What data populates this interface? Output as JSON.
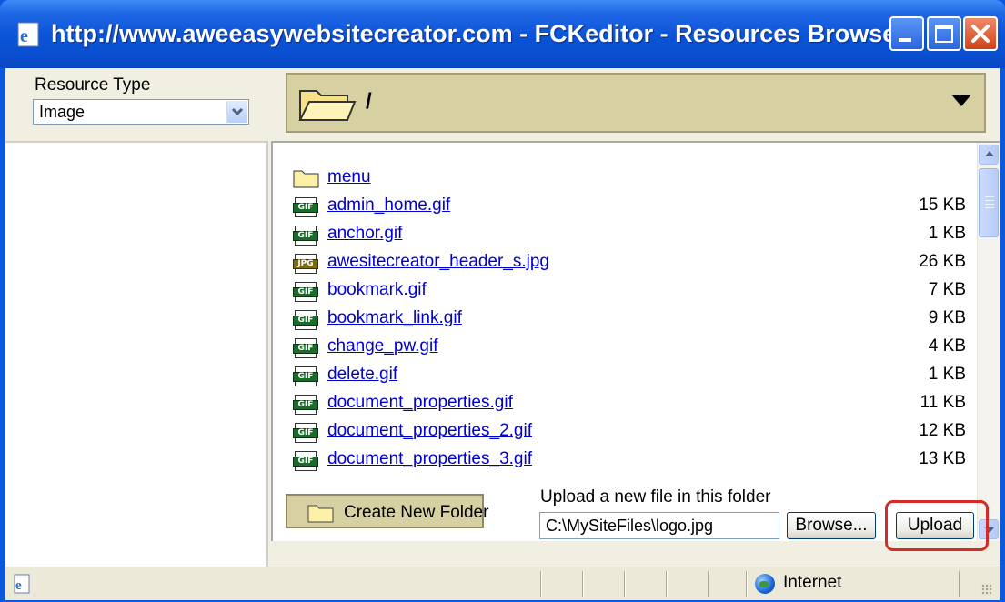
{
  "window": {
    "title": "http://www.aweeasywebsitecreator.com - FCKeditor - Resources Browser - Mi..."
  },
  "resource_type": {
    "label": "Resource Type",
    "selected": "Image"
  },
  "folder_bar": {
    "path": "/"
  },
  "files": [
    {
      "name": "menu",
      "size": "",
      "kind": "folder"
    },
    {
      "name": "admin_home.gif",
      "size": "15 KB",
      "kind": "gif"
    },
    {
      "name": "anchor.gif",
      "size": "1 KB",
      "kind": "gif"
    },
    {
      "name": "awesitecreator_header_s.jpg",
      "size": "26 KB",
      "kind": "jpg"
    },
    {
      "name": "bookmark.gif",
      "size": "7 KB",
      "kind": "gif"
    },
    {
      "name": "bookmark_link.gif",
      "size": "9 KB",
      "kind": "gif"
    },
    {
      "name": "change_pw.gif",
      "size": "4 KB",
      "kind": "gif"
    },
    {
      "name": "delete.gif",
      "size": "1 KB",
      "kind": "gif"
    },
    {
      "name": "document_properties.gif",
      "size": "11 KB",
      "kind": "gif"
    },
    {
      "name": "document_properties_2.gif",
      "size": "12 KB",
      "kind": "gif"
    },
    {
      "name": "document_properties_3.gif",
      "size": "13 KB",
      "kind": "gif"
    }
  ],
  "icon_labels": {
    "gif": "GIF",
    "jpg": "JPG"
  },
  "bottom": {
    "create_folder_label": "Create New Folder",
    "upload_label": "Upload a new file in this folder",
    "file_value": "C:\\MySiteFiles\\logo.jpg",
    "browse_label": "Browse...",
    "upload_button": "Upload"
  },
  "status": {
    "zone": "Internet"
  },
  "colors": {
    "highlight": "#d42a2a",
    "link": "#0000cc",
    "folder_bar": "#d7d0a3"
  }
}
